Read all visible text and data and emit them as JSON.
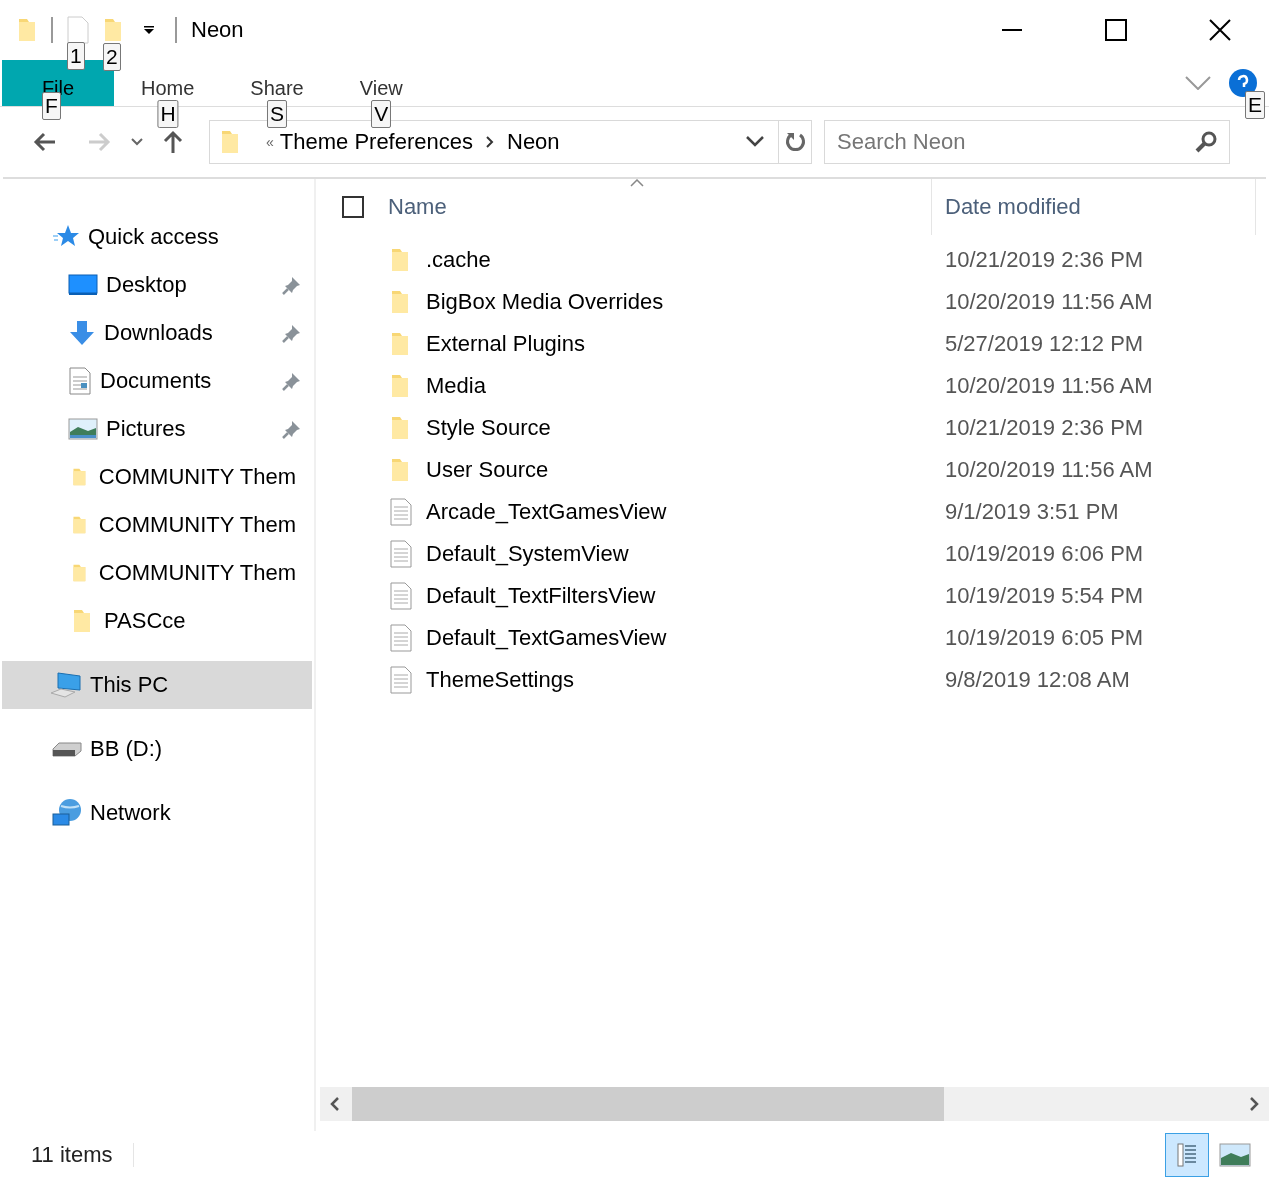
{
  "window": {
    "title": "Neon",
    "keytips": [
      "1",
      "2"
    ]
  },
  "ribbon": {
    "tabs": [
      {
        "label": "File",
        "kind": "file",
        "keytip": "F",
        "selected": true
      },
      {
        "label": "Home",
        "kind": "tab",
        "keytip": "H",
        "selected": false
      },
      {
        "label": "Share",
        "kind": "tab",
        "keytip": "S",
        "selected": false
      },
      {
        "label": "View",
        "kind": "tab",
        "keytip": "V",
        "selected": false
      }
    ],
    "help_keytip": "E"
  },
  "address": {
    "overflow": "«",
    "path": [
      "Theme Preferences",
      "Neon"
    ]
  },
  "search": {
    "placeholder": "Search Neon"
  },
  "sidebar": {
    "items": [
      {
        "label": "Quick access",
        "kind": "star",
        "pinned": false,
        "selected": false
      },
      {
        "label": "Desktop",
        "kind": "desktop",
        "pinned": true,
        "selected": false
      },
      {
        "label": "Downloads",
        "kind": "download",
        "pinned": true,
        "selected": false
      },
      {
        "label": "Documents",
        "kind": "document",
        "pinned": true,
        "selected": false
      },
      {
        "label": "Pictures",
        "kind": "pictures",
        "pinned": true,
        "selected": false
      },
      {
        "label": "COMMUNITY Them",
        "kind": "folder",
        "pinned": false,
        "selected": false
      },
      {
        "label": "COMMUNITY Them",
        "kind": "folder",
        "pinned": false,
        "selected": false
      },
      {
        "label": "COMMUNITY Them",
        "kind": "folder",
        "pinned": false,
        "selected": false
      },
      {
        "label": "PASCce",
        "kind": "folder",
        "pinned": false,
        "selected": false
      },
      {
        "label": "This PC",
        "kind": "pc",
        "pinned": false,
        "selected": true
      },
      {
        "label": "BB (D:)",
        "kind": "drive",
        "pinned": false,
        "selected": false
      },
      {
        "label": "Network",
        "kind": "network",
        "pinned": false,
        "selected": false
      }
    ]
  },
  "table": {
    "columns": [
      "Name",
      "Date modified"
    ],
    "select_all": {
      "checked": false
    },
    "rows": [
      {
        "name": ".cache",
        "kind": "folder",
        "date": "10/21/2019 2:36 PM"
      },
      {
        "name": "BigBox Media Overrides",
        "kind": "folder",
        "date": "10/20/2019 11:56 AM"
      },
      {
        "name": "External Plugins",
        "kind": "folder",
        "date": "5/27/2019 12:12 PM"
      },
      {
        "name": "Media",
        "kind": "folder",
        "date": "10/20/2019 11:56 AM"
      },
      {
        "name": "Style Source",
        "kind": "folder",
        "date": "10/21/2019 2:36 PM"
      },
      {
        "name": "User Source",
        "kind": "folder",
        "date": "10/20/2019 11:56 AM"
      },
      {
        "name": "Arcade_TextGamesView",
        "kind": "file",
        "date": "9/1/2019 3:51 PM"
      },
      {
        "name": "Default_SystemView",
        "kind": "file",
        "date": "10/19/2019 6:06 PM"
      },
      {
        "name": "Default_TextFiltersView",
        "kind": "file",
        "date": "10/19/2019 5:54 PM"
      },
      {
        "name": "Default_TextGamesView",
        "kind": "file",
        "date": "10/19/2019 6:05 PM"
      },
      {
        "name": "ThemeSettings",
        "kind": "file",
        "date": "9/8/2019 12:08 AM"
      }
    ]
  },
  "status_bar": {
    "count": "11 items",
    "views": [
      {
        "kind": "details",
        "selected": true
      },
      {
        "kind": "large",
        "selected": false
      }
    ]
  }
}
